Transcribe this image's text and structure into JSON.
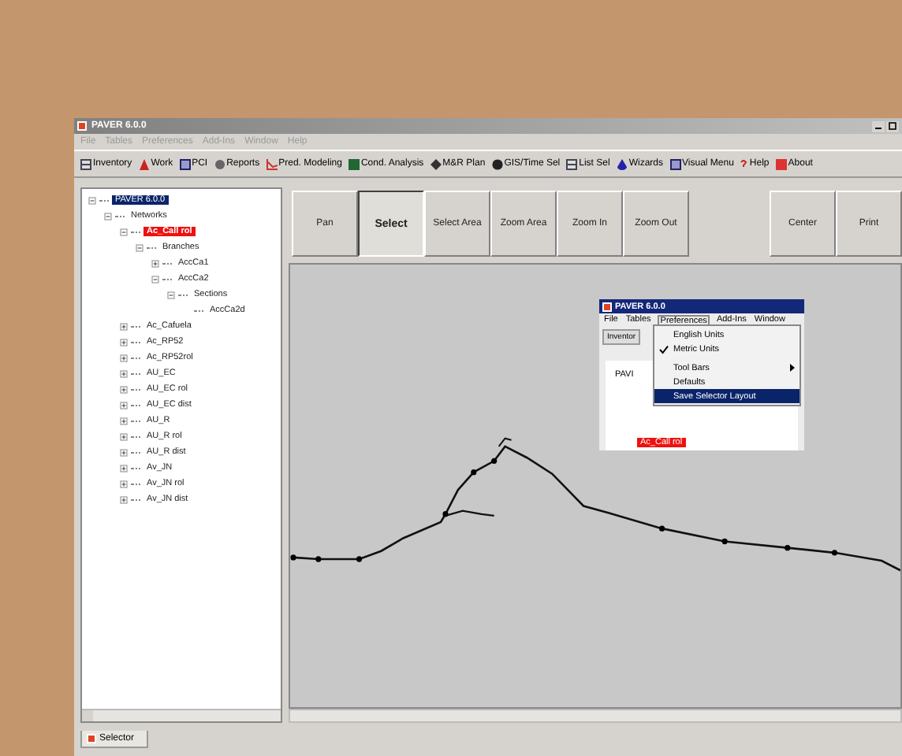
{
  "window": {
    "title": "PAVER 6.0.0"
  },
  "menu": [
    {
      "label": "File"
    },
    {
      "label": "Tables"
    },
    {
      "label": "Preferences"
    },
    {
      "label": "Add-Ins"
    },
    {
      "label": "Window"
    },
    {
      "label": "Help"
    }
  ],
  "toolbar": [
    {
      "label": "Inventory"
    },
    {
      "label": "Work"
    },
    {
      "label": "PCI"
    },
    {
      "label": "Reports"
    },
    {
      "label": "Pred. Modeling"
    },
    {
      "label": "Cond. Analysis"
    },
    {
      "label": "M&R Plan"
    },
    {
      "label": "GIS/Time Sel"
    },
    {
      "label": "List Sel"
    },
    {
      "label": "Wizards"
    },
    {
      "label": "Visual Menu"
    },
    {
      "label": "Help"
    },
    {
      "label": "About"
    }
  ],
  "tree": [
    {
      "label": "PAVER 6.0.0",
      "selected": true,
      "flagged": false,
      "expanded": true,
      "children": [
        {
          "label": "Networks",
          "selected": false,
          "flagged": false,
          "expanded": true,
          "children": [
            {
              "label": "Ac_Call rol",
              "selected": false,
              "flagged": true,
              "expanded": true,
              "children": [
                {
                  "label": "Branches",
                  "selected": false,
                  "flagged": false,
                  "expanded": true,
                  "children": [
                    {
                      "label": "AccCa1",
                      "selected": false,
                      "flagged": false,
                      "expanded": false
                    },
                    {
                      "label": "AccCa2",
                      "selected": false,
                      "flagged": false,
                      "expanded": true,
                      "children": [
                        {
                          "label": "Sections",
                          "selected": false,
                          "flagged": false,
                          "expanded": true,
                          "children": [
                            {
                              "label": "AccCa2d",
                              "selected": false,
                              "flagged": false
                            }
                          ]
                        }
                      ]
                    }
                  ]
                }
              ]
            },
            {
              "label": "Ac_Cafuela",
              "selected": false,
              "flagged": false,
              "expanded": false
            },
            {
              "label": "Ac_RP52",
              "selected": false,
              "flagged": false,
              "expanded": false
            },
            {
              "label": "Ac_RP52rol",
              "selected": false,
              "flagged": false,
              "expanded": false
            },
            {
              "label": "AU_EC",
              "selected": false,
              "flagged": false,
              "expanded": false
            },
            {
              "label": "AU_EC rol",
              "selected": false,
              "flagged": false,
              "expanded": false
            },
            {
              "label": "AU_EC dist",
              "selected": false,
              "flagged": false,
              "expanded": false
            },
            {
              "label": "AU_R",
              "selected": false,
              "flagged": false,
              "expanded": false
            },
            {
              "label": "AU_R rol",
              "selected": false,
              "flagged": false,
              "expanded": false
            },
            {
              "label": "AU_R dist",
              "selected": false,
              "flagged": false,
              "expanded": false
            },
            {
              "label": "Av_JN",
              "selected": false,
              "flagged": false,
              "expanded": false
            },
            {
              "label": "Av_JN rol",
              "selected": false,
              "flagged": false,
              "expanded": false
            },
            {
              "label": "Av_JN dist",
              "selected": false,
              "flagged": false,
              "expanded": false
            }
          ]
        }
      ]
    }
  ],
  "map_tools": [
    {
      "label": "Pan",
      "selected": false
    },
    {
      "label": "Select",
      "selected": true
    },
    {
      "label": "Select Area",
      "selected": false
    },
    {
      "label": "Zoom Area",
      "selected": false
    },
    {
      "label": "Zoom In",
      "selected": false
    },
    {
      "label": "Zoom Out",
      "selected": false
    }
  ],
  "map_actions": [
    {
      "label": "Center"
    },
    {
      "label": "Print"
    }
  ],
  "inset": {
    "title": "PAVER 6.0.0",
    "menu": [
      {
        "label": "File",
        "selected": false
      },
      {
        "label": "Tables",
        "selected": false
      },
      {
        "label": "Preferences",
        "selected": true
      },
      {
        "label": "Add-Ins",
        "selected": false
      },
      {
        "label": "Window",
        "selected": false
      }
    ],
    "toolbar_label": "Inventor",
    "tree_labels": [
      {
        "label": "PAVI",
        "flagged": false
      },
      {
        "label": "Ac_Call rol",
        "flagged": true
      }
    ],
    "dropdown": [
      {
        "label": "English Units",
        "kind": "item",
        "checked": false,
        "selected": false
      },
      {
        "label": "Metric Units",
        "kind": "item",
        "checked": true,
        "selected": false
      },
      {
        "kind": "separator"
      },
      {
        "label": "Tool Bars",
        "kind": "submenu",
        "checked": false,
        "selected": false
      },
      {
        "label": "Defaults",
        "kind": "item",
        "checked": false,
        "selected": false
      },
      {
        "label": "Save Selector Layout",
        "kind": "item",
        "checked": false,
        "selected": true
      }
    ]
  },
  "bottom_tabs": [
    {
      "label": "Selector",
      "selected": true
    }
  ]
}
